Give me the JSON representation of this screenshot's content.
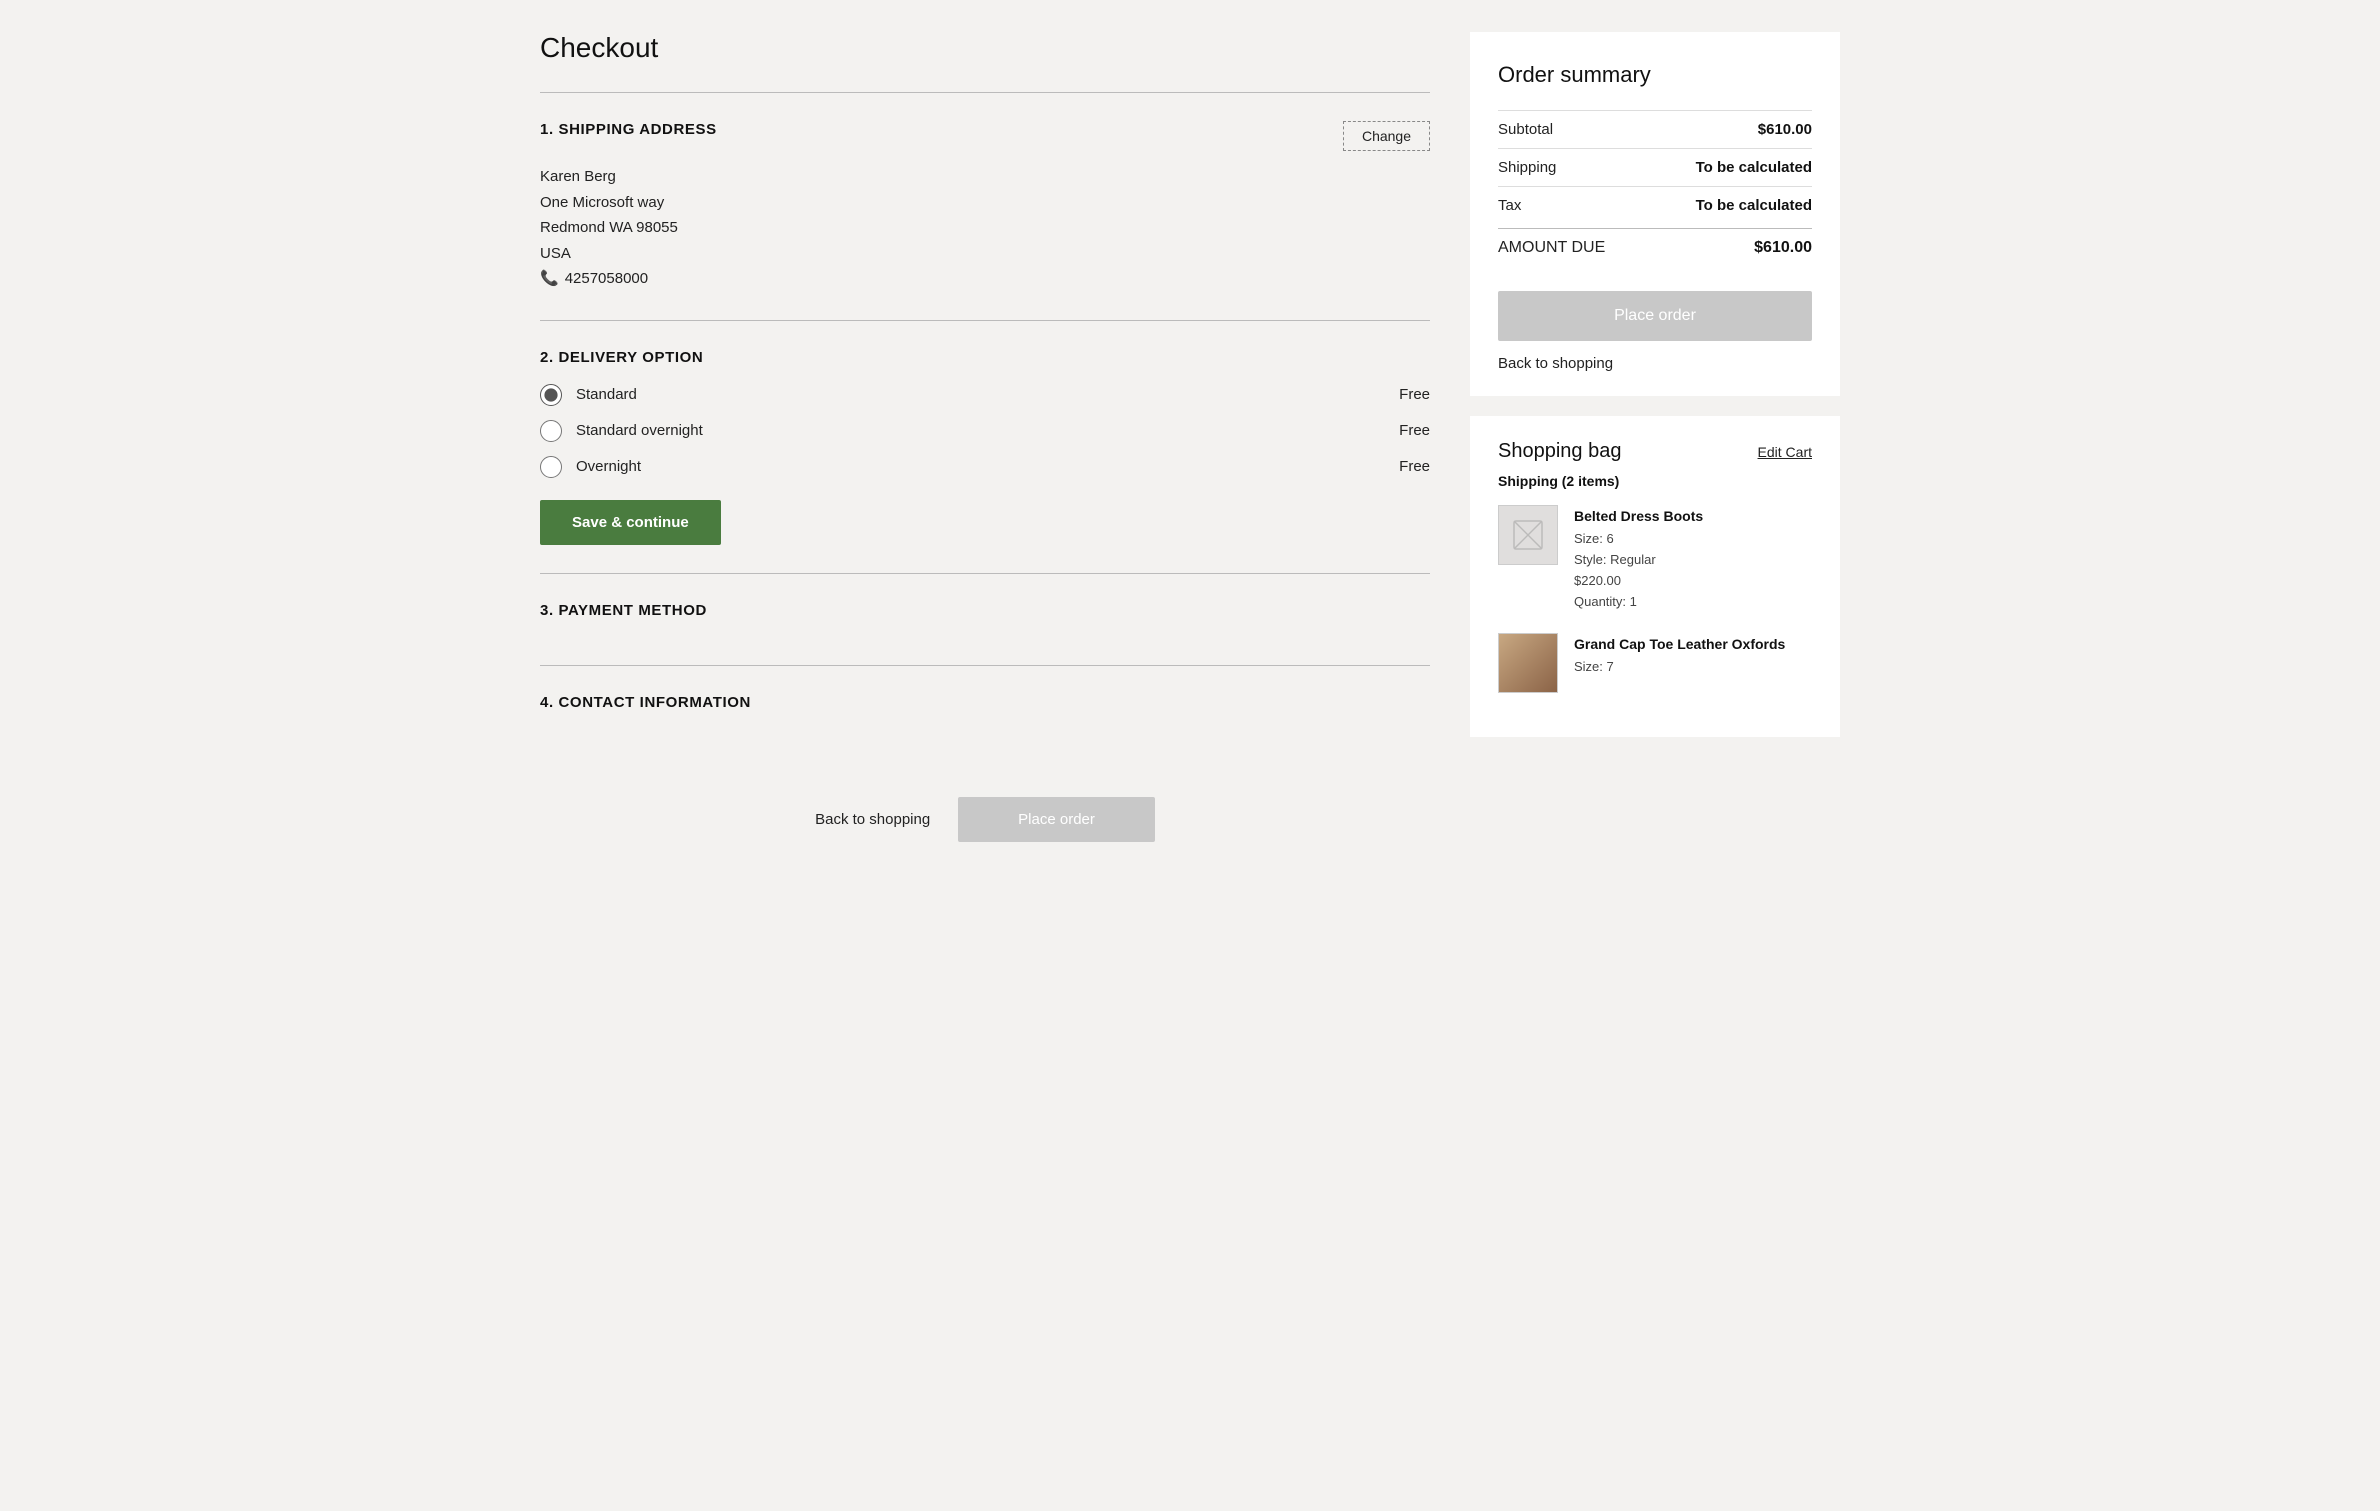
{
  "page": {
    "title": "Checkout"
  },
  "sections": {
    "shipping": {
      "number": "1.",
      "title": "SHIPPING ADDRESS",
      "change_label": "Change",
      "address": {
        "name": "Karen Berg",
        "line1": "One Microsoft way",
        "line2": "Redmond WA  98055",
        "country": "USA",
        "phone": "4257058000"
      }
    },
    "delivery": {
      "number": "2.",
      "title": "DELIVERY OPTION",
      "options": [
        {
          "id": "standard",
          "label": "Standard",
          "price": "Free",
          "checked": true
        },
        {
          "id": "standard-overnight",
          "label": "Standard overnight",
          "price": "Free",
          "checked": false
        },
        {
          "id": "overnight",
          "label": "Overnight",
          "price": "Free",
          "checked": false
        }
      ],
      "save_button_label": "Save & continue"
    },
    "payment": {
      "number": "3.",
      "title": "PAYMENT METHOD"
    },
    "contact": {
      "number": "4.",
      "title": "CONTACT INFORMATION"
    }
  },
  "bottom_actions": {
    "back_label": "Back to shopping",
    "place_order_label": "Place order"
  },
  "order_summary": {
    "title": "Order summary",
    "rows": [
      {
        "label": "Subtotal",
        "value": "$610.00",
        "bold": true
      },
      {
        "label": "Shipping",
        "value": "To be calculated",
        "bold": false
      },
      {
        "label": "Tax",
        "value": "To be calculated",
        "bold": false
      },
      {
        "label": "AMOUNT DUE",
        "value": "$610.00",
        "bold": true
      }
    ],
    "place_order_label": "Place order",
    "back_label": "Back to shopping"
  },
  "shopping_bag": {
    "title": "Shopping bag",
    "edit_cart_label": "Edit Cart",
    "items_label": "Shipping (2 items)",
    "items": [
      {
        "name": "Belted Dress Boots",
        "size": "Size: 6",
        "style": "Style: Regular",
        "price": "$220.00",
        "quantity": "Quantity: 1",
        "has_image": false
      },
      {
        "name": "Grand Cap Toe Leather Oxfords",
        "size": "Size: 7",
        "has_image": true
      }
    ]
  }
}
